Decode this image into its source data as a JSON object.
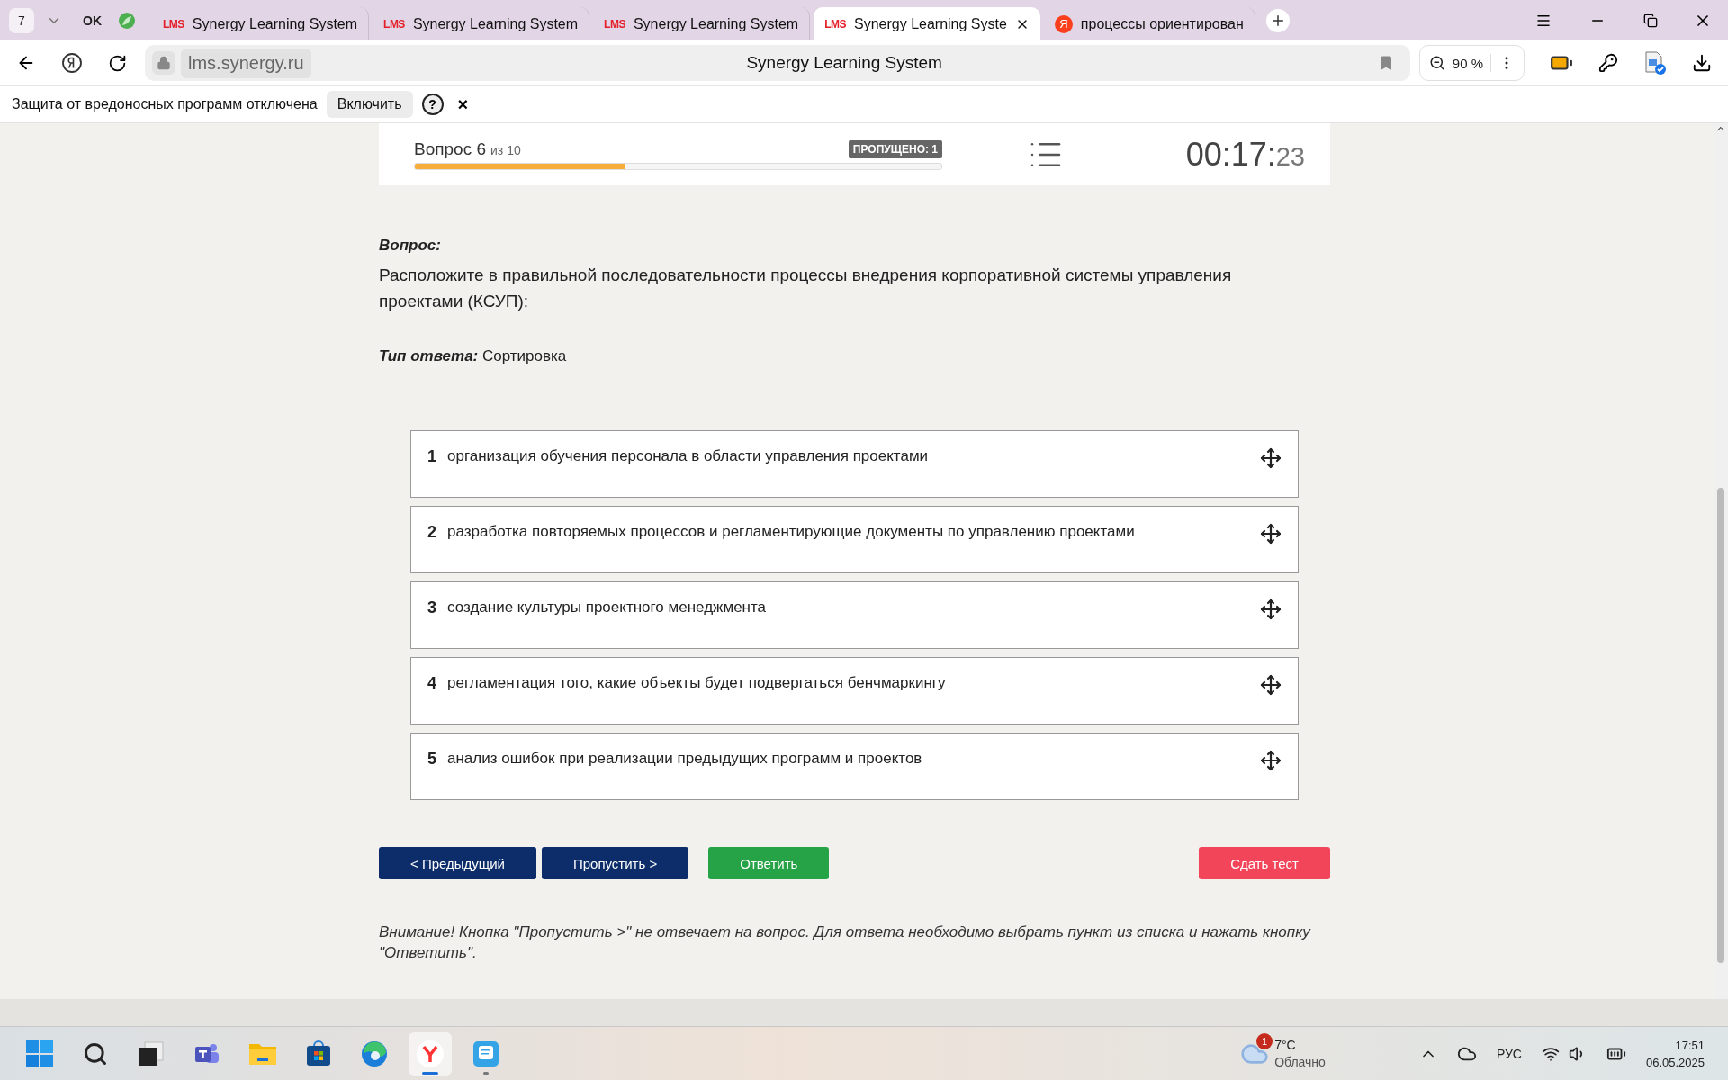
{
  "browser": {
    "tab_count": "7",
    "pinned": [
      {
        "kind": "text",
        "label": "OK"
      },
      {
        "kind": "leaf"
      }
    ],
    "tabs": [
      {
        "logo": "LMS",
        "kind": "lms",
        "title": "Synergy Learning System",
        "selected": false
      },
      {
        "logo": "LMS",
        "kind": "lms",
        "title": "Synergy Learning System",
        "selected": false
      },
      {
        "logo": "LMS",
        "kind": "lms",
        "title": "Synergy Learning System",
        "selected": false
      },
      {
        "logo": "LMS",
        "kind": "lms",
        "title": "Synergy Learning Syste",
        "selected": true
      },
      {
        "logo": "Я",
        "kind": "yandex",
        "title": "процессы ориентирован",
        "selected": false
      }
    ],
    "address": "lms.synergy.ru",
    "page_title": "Synergy Learning System",
    "zoom": "90 %"
  },
  "notice": {
    "text": "Защита от вредоносных программ отключена",
    "button": "Включить",
    "help": "?",
    "close": "×"
  },
  "quiz": {
    "question_label": "Вопрос 6",
    "question_of": "из 10",
    "level": 0.4,
    "skipped": "ПРОПУЩЕНО: 1",
    "timer_main": "00:17:",
    "timer_seconds": "23"
  },
  "question": {
    "heading": "Вопрос:",
    "text": "Расположите в правильной последовательности процессы внедрения корпоративной системы управления проектами (КСУП):",
    "answer_type_label": "Тип ответа:",
    "answer_type": "Сортировка"
  },
  "items": [
    {
      "number": "1",
      "text": "организация обучения персонала в области управления проектами"
    },
    {
      "number": "2",
      "text": "разработка повторяемых процессов и регламентирующие документы по управлению проектами"
    },
    {
      "number": "3",
      "text": "создание культуры проектного менеджмента"
    },
    {
      "number": "4",
      "text": "регламентация того, какие объекты будет подвергаться бенчмаркингу"
    },
    {
      "number": "5",
      "text": "анализ ошибок при реализации предыдущих программ и проектов"
    }
  ],
  "buttons": [
    {
      "kind": "primary",
      "label": "< Предыдущий"
    },
    {
      "kind": "primary",
      "label": "Пропустить >"
    },
    {
      "kind": "success",
      "label": "Ответить"
    },
    {
      "kind": "danger",
      "label": "Сдать тест"
    }
  ],
  "warning": "Внимание! Кнопка \"Пропустить >\" не отвечает на вопрос. Для ответа необходимо выбрать пункт из списка и нажать кнопку \"Ответить\".",
  "taskbar": {
    "apps": [
      {
        "kind": "start",
        "selected": false
      },
      {
        "kind": "search",
        "selected": false
      },
      {
        "kind": "taskview",
        "selected": false
      },
      {
        "kind": "teams",
        "selected": false
      },
      {
        "kind": "explorer",
        "selected": false
      },
      {
        "kind": "store",
        "selected": false
      },
      {
        "kind": "edge",
        "selected": false
      },
      {
        "kind": "yandex",
        "selected": true
      },
      {
        "kind": "notes",
        "selected": false
      }
    ],
    "weather": {
      "badge": "1",
      "temp": "7°C",
      "condition": "Облачно"
    },
    "language": "РУС",
    "time": "17:51",
    "date": "06.05.2025"
  }
}
